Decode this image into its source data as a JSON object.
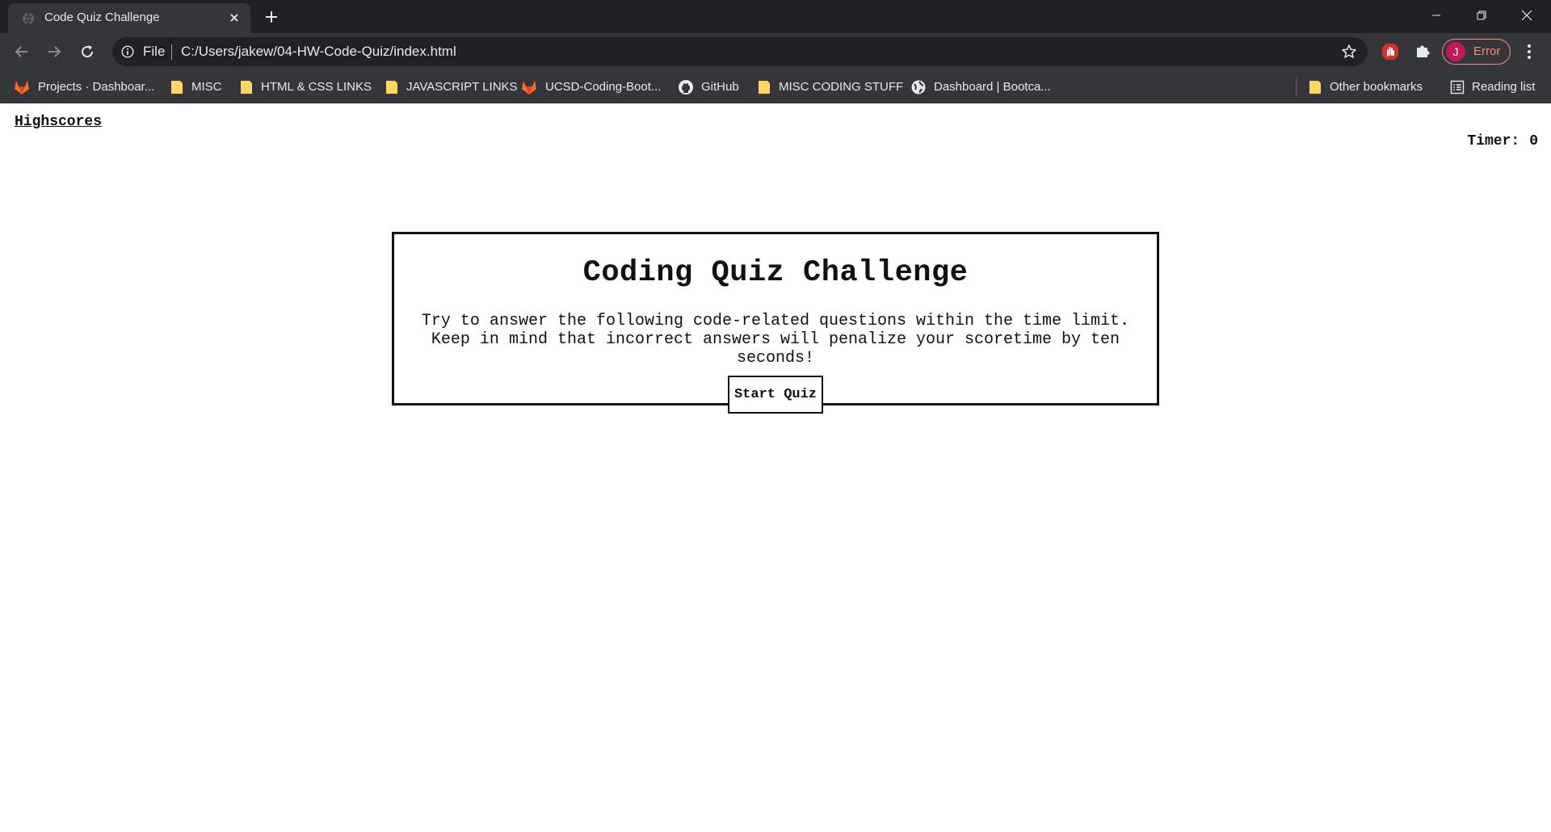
{
  "browser": {
    "tab_title": "Code Quiz Challenge",
    "scheme_label": "File",
    "url": "C:/Users/jakew/04-HW-Code-Quiz/index.html",
    "profile_initial": "J",
    "profile_status": "Error",
    "bookmarks": [
      {
        "label": "Projects · Dashboar...",
        "icon": "gitlab-icon"
      },
      {
        "label": "MISC",
        "icon": "folder-icon"
      },
      {
        "label": "HTML & CSS LINKS",
        "icon": "folder-icon"
      },
      {
        "label": "JAVASCRIPT LINKS",
        "icon": "folder-icon"
      },
      {
        "label": "UCSD-Coding-Boot...",
        "icon": "gitlab-icon"
      },
      {
        "label": "GitHub",
        "icon": "github-icon"
      },
      {
        "label": "MISC CODING STUFF",
        "icon": "folder-icon"
      },
      {
        "label": "Dashboard | Bootca...",
        "icon": "globe-icon"
      }
    ],
    "other_bookmarks": "Other bookmarks",
    "reading_list": "Reading list",
    "colors": {
      "chrome_dark": "#202124",
      "chrome_tab": "#35363a",
      "profile_error": "#f28b82",
      "folder": "#fdd663"
    }
  },
  "page": {
    "highscores_link": "Highscores",
    "timer_label": "Timer:",
    "timer_value": "0",
    "quiz": {
      "title": "Coding Quiz Challenge",
      "description": "Try to answer the following code-related questions within the time limit. Keep in mind that incorrect answers will penalize your scoretime by ten seconds!",
      "start_button": "Start Quiz"
    }
  }
}
